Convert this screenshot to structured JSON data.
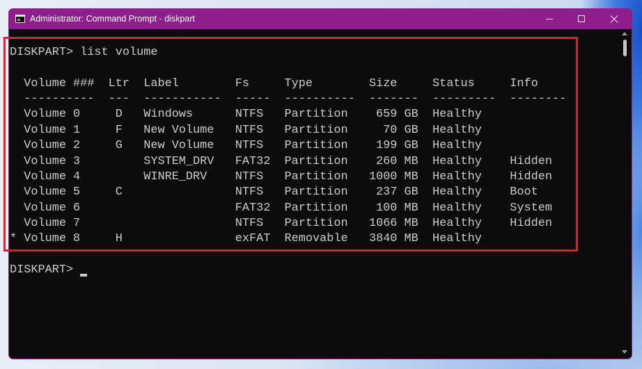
{
  "window": {
    "title": "Administrator: Command Prompt - diskpart",
    "icon": "command-prompt-icon",
    "controls": [
      {
        "name": "minimize",
        "icon": "minimize-icon"
      },
      {
        "name": "maximize",
        "icon": "maximize-icon"
      },
      {
        "name": "close",
        "icon": "close-icon"
      }
    ]
  },
  "colors": {
    "title_bar": "#8d1e8c",
    "console_background": "#0c0c0c",
    "console_text": "#cccccc",
    "highlight_box": "#d8232b"
  },
  "console": {
    "prompt": "DISKPART>",
    "command": "list volume",
    "headers": {
      "volume": "Volume ###",
      "ltr": "Ltr",
      "label": "Label",
      "fs": "Fs",
      "type": "Type",
      "size": "Size",
      "status": "Status",
      "info": "Info"
    },
    "rules": {
      "volume": "----------",
      "ltr": "---",
      "label": "-----------",
      "fs": "-----",
      "type": "----------",
      "size": "-------",
      "status": "---------",
      "info": "--------"
    },
    "volumes": [
      {
        "volume": "Volume 0",
        "ltr": "D",
        "label": "Windows",
        "fs": "NTFS",
        "type": "Partition",
        "size": "659 GB",
        "status": "Healthy"
      },
      {
        "volume": "Volume 1",
        "ltr": "F",
        "label": "New Volume",
        "fs": "NTFS",
        "type": "Partition",
        "size": "70 GB",
        "status": "Healthy"
      },
      {
        "volume": "Volume 2",
        "ltr": "G",
        "label": "New Volume",
        "fs": "NTFS",
        "type": "Partition",
        "size": "199 GB",
        "status": "Healthy"
      },
      {
        "volume": "Volume 3",
        "label": "SYSTEM_DRV",
        "fs": "FAT32",
        "type": "Partition",
        "size": "260 MB",
        "status": "Healthy",
        "info": "Hidden"
      },
      {
        "volume": "Volume 4",
        "label": "WINRE_DRV",
        "fs": "NTFS",
        "type": "Partition",
        "size": "1000 MB",
        "status": "Healthy",
        "info": "Hidden"
      },
      {
        "volume": "Volume 5",
        "ltr": "C",
        "fs": "NTFS",
        "type": "Partition",
        "size": "237 GB",
        "status": "Healthy",
        "info": "Boot"
      },
      {
        "volume": "Volume 6",
        "fs": "FAT32",
        "type": "Partition",
        "size": "100 MB",
        "status": "Healthy",
        "info": "System"
      },
      {
        "volume": "Volume 7",
        "fs": "NTFS",
        "type": "Partition",
        "size": "1066 MB",
        "status": "Healthy",
        "info": "Hidden"
      },
      {
        "marker": "*",
        "volume": "Volume 8",
        "ltr": "H",
        "fs": "exFAT",
        "type": "Removable",
        "size": "3840 MB",
        "status": "Healthy"
      }
    ],
    "prompt_next": "DISKPART>"
  }
}
